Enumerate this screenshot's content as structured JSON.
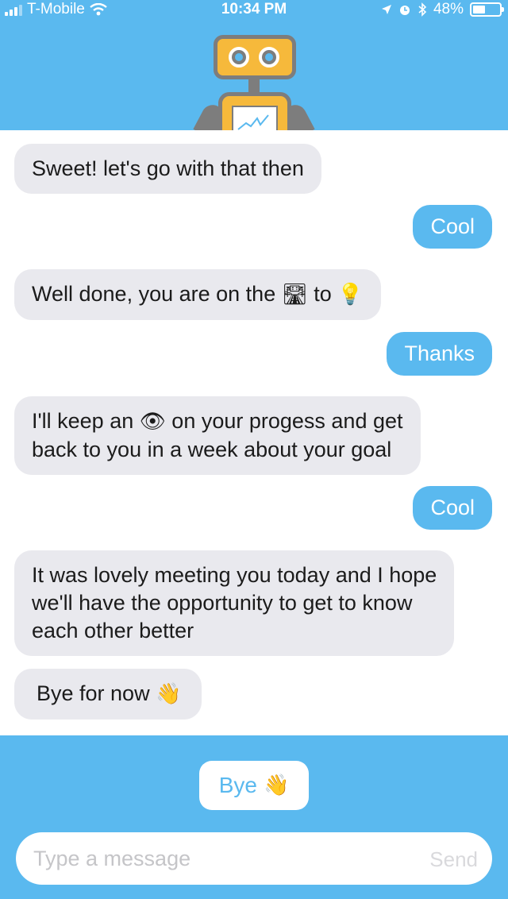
{
  "status_bar": {
    "carrier": "T-Mobile",
    "time": "10:34 PM",
    "battery": "48%"
  },
  "messages": [
    {
      "from": "bot",
      "text": "Sweet! let's go with that then"
    },
    {
      "from": "user",
      "text": "Cool"
    },
    {
      "from": "bot",
      "parts": [
        "Well done, you are on the",
        "🛣",
        "to",
        "💡"
      ]
    },
    {
      "from": "user",
      "text": "Thanks"
    },
    {
      "from": "bot",
      "parts": [
        "I'll keep an",
        "👁",
        "on your progess and get",
        "back to you in a week about your goal"
      ]
    },
    {
      "from": "user",
      "text": "Cool"
    },
    {
      "from": "bot",
      "lines": [
        "It was lovely meeting you today and I hope",
        "we'll have the opportunity to get to know",
        "each other better"
      ]
    },
    {
      "from": "bot",
      "parts": [
        "Bye for now",
        "👋"
      ]
    }
  ],
  "quick_reply": {
    "label": "Bye",
    "emoji": "👋"
  },
  "composer": {
    "placeholder": "Type a message",
    "send_label": "Send"
  },
  "colors": {
    "accent": "#5ab9ef",
    "bot_bubble": "#e9e9ee",
    "robot_yellow": "#f6b93b"
  }
}
